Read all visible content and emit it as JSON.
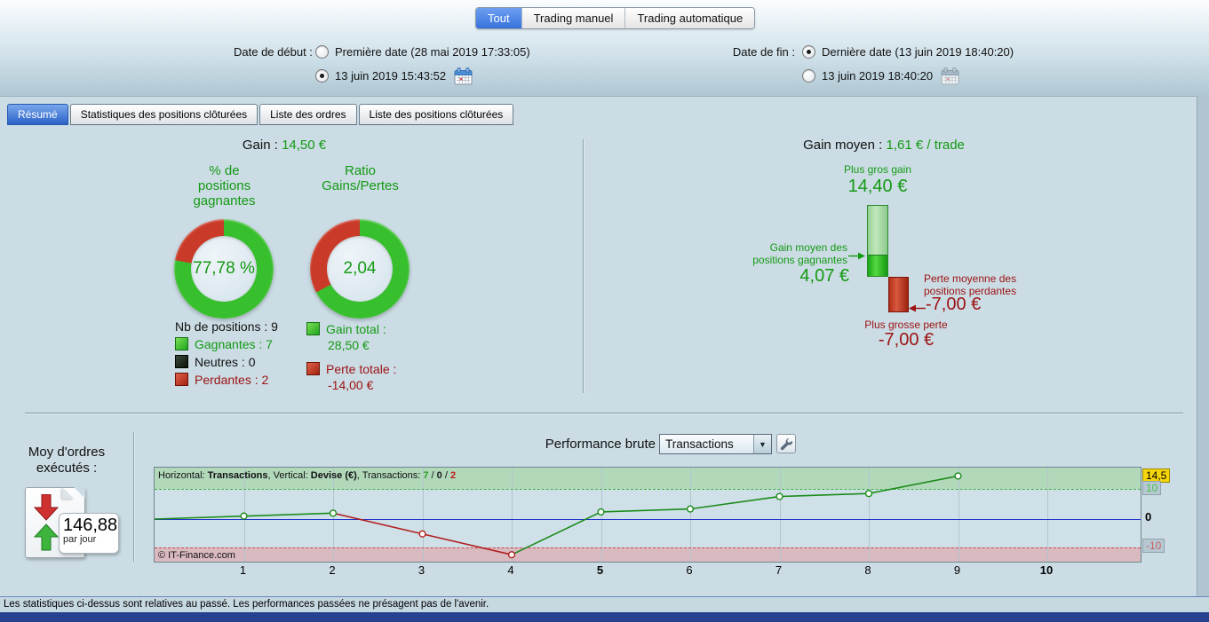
{
  "colors": {
    "accent_blue": "#3672dc",
    "green_text": "#149a14",
    "dark_red_text": "#9c1212",
    "donut_green": "#38bf2e",
    "donut_red": "#c93a28",
    "series_green": "#1b8c1b",
    "series_red": "#b22020",
    "badge_yellow": "#f6d60a"
  },
  "top_tabs": {
    "all": "Tout",
    "manual": "Trading manuel",
    "auto": "Trading automatique"
  },
  "date_start": {
    "label": "Date de début :",
    "first_date_option": "Première date (28 mai 2019 17:33:05)",
    "custom_date_option": "13 juin 2019 15:43:52",
    "selected_option": "custom_date_option"
  },
  "date_end": {
    "label": "Date de fin :",
    "last_date_option": "Dernière date (13 juin 2019 18:40:20)",
    "custom_date_option": "13 juin 2019 18:40:20",
    "selected_option": "last_date_option"
  },
  "view_tabs": {
    "summary": "Résumé",
    "stats": "Statistiques des positions clôturées",
    "orders": "Liste des ordres",
    "closed": "Liste des positions clôturées"
  },
  "summary": {
    "gain_label": "Gain :",
    "gain_value": "14,50 €",
    "winning_pct_title": "% de positions gagnantes",
    "ratio_title": "Ratio Gains/Pertes",
    "winning_pct_value": "77,78 %",
    "winning_pct_number": 77.78,
    "ratio_value": "2,04",
    "ratio_green_pct": 67.1,
    "legend": {
      "total": "Nb de positions : 9",
      "winning": "Gagnantes : 7",
      "neutral": "Neutres : 0",
      "losing": "Perdantes : 2"
    },
    "gain_total_label": "Gain total :",
    "gain_total_value": "28,50 €",
    "loss_total_label": "Perte totale :",
    "loss_total_value": "-14,00 €"
  },
  "average": {
    "title_label": "Gain moyen :",
    "title_value": "1,61 € / trade",
    "biggest_gain_label": "Plus gros gain",
    "biggest_gain_value": "14,40 €",
    "avg_win_label": "Gain moyen des positions gagnantes",
    "avg_win_value": "4,07 €",
    "avg_loss_label": "Perte moyenne des positions perdantes",
    "avg_loss_value": "-7,00 €",
    "biggest_loss_label": "Plus grosse perte",
    "biggest_loss_value": "-7,00 €"
  },
  "orders_panel": {
    "title": "Moy d'ordres exécutés :",
    "value": "146,88",
    "unit": "par jour"
  },
  "performance": {
    "title": "Performance brute",
    "dropdown_value": "Transactions",
    "header": {
      "h_label": "Horizontal: ",
      "h_value": "Transactions",
      "v_label": ", Vertical: ",
      "v_value": "Devise (€)",
      "t_label": ", Transactions: ",
      "wins": "7",
      "sep1": " / ",
      "neutral": "0",
      "sep2": " / ",
      "losses": "2"
    },
    "copyright": "© IT-Finance.com"
  },
  "chart_data": {
    "type": "line",
    "title": "Performance brute",
    "xlabel": "Transactions",
    "ylabel": "Devise (€)",
    "x": [
      0,
      1,
      2,
      3,
      4,
      5,
      6,
      7,
      8,
      9
    ],
    "values": [
      0,
      1.0,
      2.0,
      -5.0,
      -12.0,
      2.4,
      3.4,
      7.6,
      8.6,
      14.5
    ],
    "x_tick_labels": [
      "1",
      "2",
      "3",
      "4",
      "5",
      "6",
      "7",
      "8",
      "9",
      "10"
    ],
    "bold_x_ticks": [
      "5",
      "10"
    ],
    "y_axis_labels": [
      "14,5",
      "10",
      "0",
      "-10"
    ],
    "zero_line": 0,
    "upper_band_threshold": 10,
    "lower_band_threshold": -10,
    "trades": {
      "wins": 7,
      "neutral": 0,
      "losses": 2
    }
  },
  "footer": {
    "disclaimer": "Les statistiques ci-dessus sont relatives au passé. Les performances passées ne présagent pas de l'avenir."
  }
}
